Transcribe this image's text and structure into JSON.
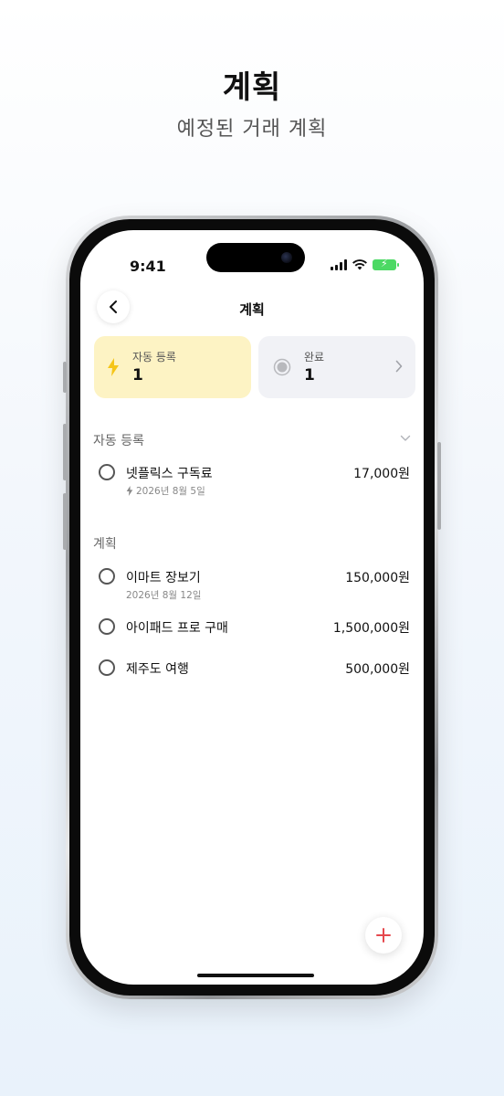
{
  "promo": {
    "title": "계획",
    "subtitle": "예정된 거래 계획"
  },
  "status_bar": {
    "time": "9:41"
  },
  "nav": {
    "title": "계획"
  },
  "summary": {
    "auto": {
      "label": "자동 등록",
      "count": "1"
    },
    "done": {
      "label": "완료",
      "count": "1"
    }
  },
  "sections": {
    "auto": {
      "header": "자동 등록",
      "items": [
        {
          "title": "넷플릭스 구독료",
          "date": "2026년 8월 5일",
          "amount": "17,000원"
        }
      ]
    },
    "plan": {
      "header": "계획",
      "items": [
        {
          "title": "이마트 장보기",
          "date": "2026년 8월 12일",
          "amount": "150,000원"
        },
        {
          "title": "아이패드 프로 구매",
          "amount": "1,500,000원"
        },
        {
          "title": "제주도 여행",
          "amount": "500,000원"
        }
      ]
    }
  },
  "colors": {
    "auto_card_bg": "#fdf3c4",
    "bolt_yellow": "#f5c518",
    "fab_plus": "#e5484d",
    "battery_green": "#4cd964"
  },
  "icons": [
    "back-chevron-icon",
    "bolt-icon",
    "radio-icon",
    "chevron-right-icon",
    "chevron-down-icon",
    "plus-icon",
    "wifi-icon",
    "signal-icon",
    "battery-icon"
  ]
}
